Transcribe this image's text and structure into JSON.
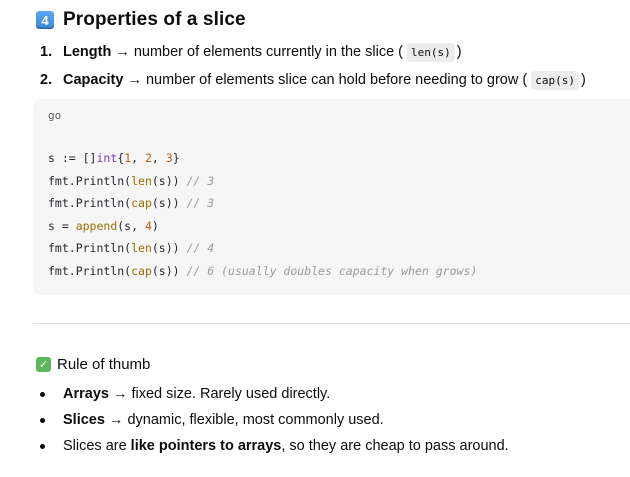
{
  "heading": {
    "badge": "4",
    "title": "Properties of a slice"
  },
  "properties": [
    {
      "num": "1.",
      "term": "Length",
      "arrow": "→",
      "desc": "number of elements currently in the slice (",
      "code": "len(s)",
      "close": ")"
    },
    {
      "num": "2.",
      "term": "Capacity",
      "arrow": "→",
      "desc": "number of elements slice can hold before needing to grow (",
      "code": "cap(s)",
      "close": ")"
    }
  ],
  "code": {
    "lang": "go",
    "lines": [
      "s := []int{1, 2, 3}",
      "fmt.Println(len(s)) // 3",
      "fmt.Println(cap(s)) // 3",
      "s = append(s, 4)",
      "fmt.Println(len(s)) // 4",
      "fmt.Println(cap(s)) // 6 (usually doubles capacity when grows)"
    ]
  },
  "rule": {
    "icon": "✓",
    "title": "Rule of thumb"
  },
  "bullets": [
    {
      "bold": "Arrays",
      "text": "→ fixed size. Rarely used directly."
    },
    {
      "bold": "Slices",
      "text": "→ dynamic, flexible, most commonly used."
    },
    {
      "pre": "Slices are",
      "bold": "like pointers to arrays",
      "text": ", so they are cheap to pass around."
    }
  ]
}
